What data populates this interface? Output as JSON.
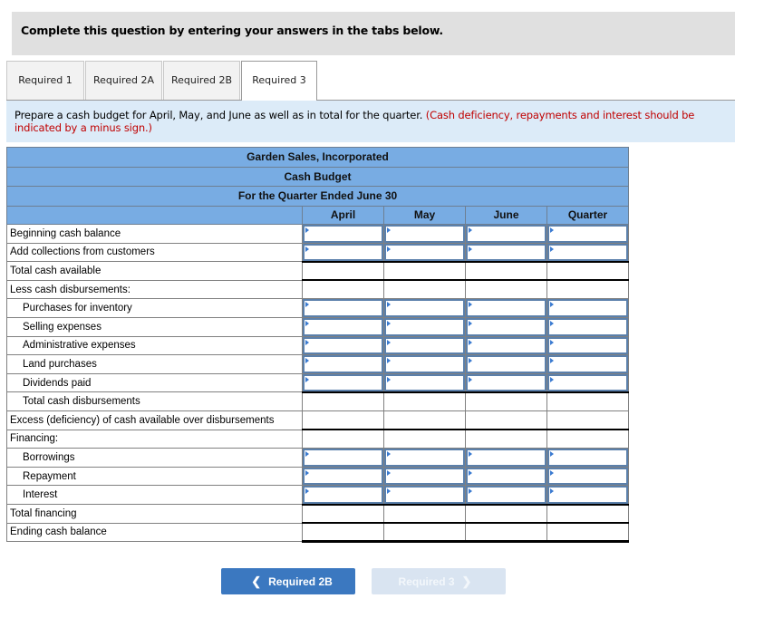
{
  "header": {
    "instruction_title": "Complete this question by entering your answers in the tabs below."
  },
  "tabs": [
    {
      "label": "Required 1",
      "active": false
    },
    {
      "label": "Required 2A",
      "active": false
    },
    {
      "label": "Required 2B",
      "active": false
    },
    {
      "label": "Required 3",
      "active": true
    }
  ],
  "instruction": {
    "text": "Prepare a cash budget for April, May, and June as well as in total for the quarter.",
    "note": "(Cash deficiency, repayments and interest should be indicated by a minus sign.)"
  },
  "budget": {
    "company": "Garden Sales, Incorporated",
    "title": "Cash Budget",
    "period": "For the Quarter Ended June 30",
    "columns": [
      "April",
      "May",
      "June",
      "Quarter"
    ],
    "rows": [
      {
        "label": "Beginning cash balance",
        "indent": false,
        "input": true,
        "values": [
          "",
          "",
          "",
          ""
        ]
      },
      {
        "label": "Add collections from customers",
        "indent": false,
        "input": true,
        "values": [
          "",
          "",
          "",
          ""
        ]
      },
      {
        "label": "Total cash available",
        "indent": false,
        "input": false,
        "values": [
          "",
          "",
          "",
          ""
        ]
      },
      {
        "label": "Less cash disbursements:",
        "indent": false,
        "input": false,
        "values": [
          "",
          "",
          "",
          ""
        ]
      },
      {
        "label": "Purchases for inventory",
        "indent": true,
        "input": true,
        "values": [
          "",
          "",
          "",
          ""
        ]
      },
      {
        "label": "Selling expenses",
        "indent": true,
        "input": true,
        "values": [
          "",
          "",
          "",
          ""
        ]
      },
      {
        "label": "Administrative expenses",
        "indent": true,
        "input": true,
        "values": [
          "",
          "",
          "",
          ""
        ]
      },
      {
        "label": "Land purchases",
        "indent": true,
        "input": true,
        "values": [
          "",
          "",
          "",
          ""
        ]
      },
      {
        "label": "Dividends paid",
        "indent": true,
        "input": true,
        "values": [
          "",
          "",
          "",
          ""
        ]
      },
      {
        "label": "Total cash disbursements",
        "indent": true,
        "input": false,
        "values": [
          "",
          "",
          "",
          ""
        ]
      },
      {
        "label": "Excess (deficiency) of cash available over disbursements",
        "indent": false,
        "input": false,
        "values": [
          "",
          "",
          "",
          ""
        ]
      },
      {
        "label": "Financing:",
        "indent": false,
        "input": false,
        "values": [
          "",
          "",
          "",
          ""
        ]
      },
      {
        "label": "Borrowings",
        "indent": true,
        "input": true,
        "values": [
          "",
          "",
          "",
          ""
        ]
      },
      {
        "label": "Repayment",
        "indent": true,
        "input": true,
        "values": [
          "",
          "",
          "",
          ""
        ]
      },
      {
        "label": "Interest",
        "indent": true,
        "input": true,
        "values": [
          "",
          "",
          "",
          ""
        ]
      },
      {
        "label": "Total financing",
        "indent": false,
        "input": false,
        "values": [
          "",
          "",
          "",
          ""
        ]
      },
      {
        "label": "Ending cash balance",
        "indent": false,
        "input": false,
        "values": [
          "",
          "",
          "",
          ""
        ]
      }
    ]
  },
  "navigation": {
    "prev_label": "Required 2B",
    "prev_icon": "chevron-left-icon",
    "next_label": "Required 3",
    "next_icon": "chevron-right-icon",
    "next_disabled": true
  },
  "colors": {
    "table_header": "#78ace3",
    "input_border": "#5b80ab",
    "prev_button": "#3b78c0",
    "next_button_disabled": "#d9e4f1",
    "note_red": "#c00000",
    "instruction_bg": "#dcebf8"
  }
}
